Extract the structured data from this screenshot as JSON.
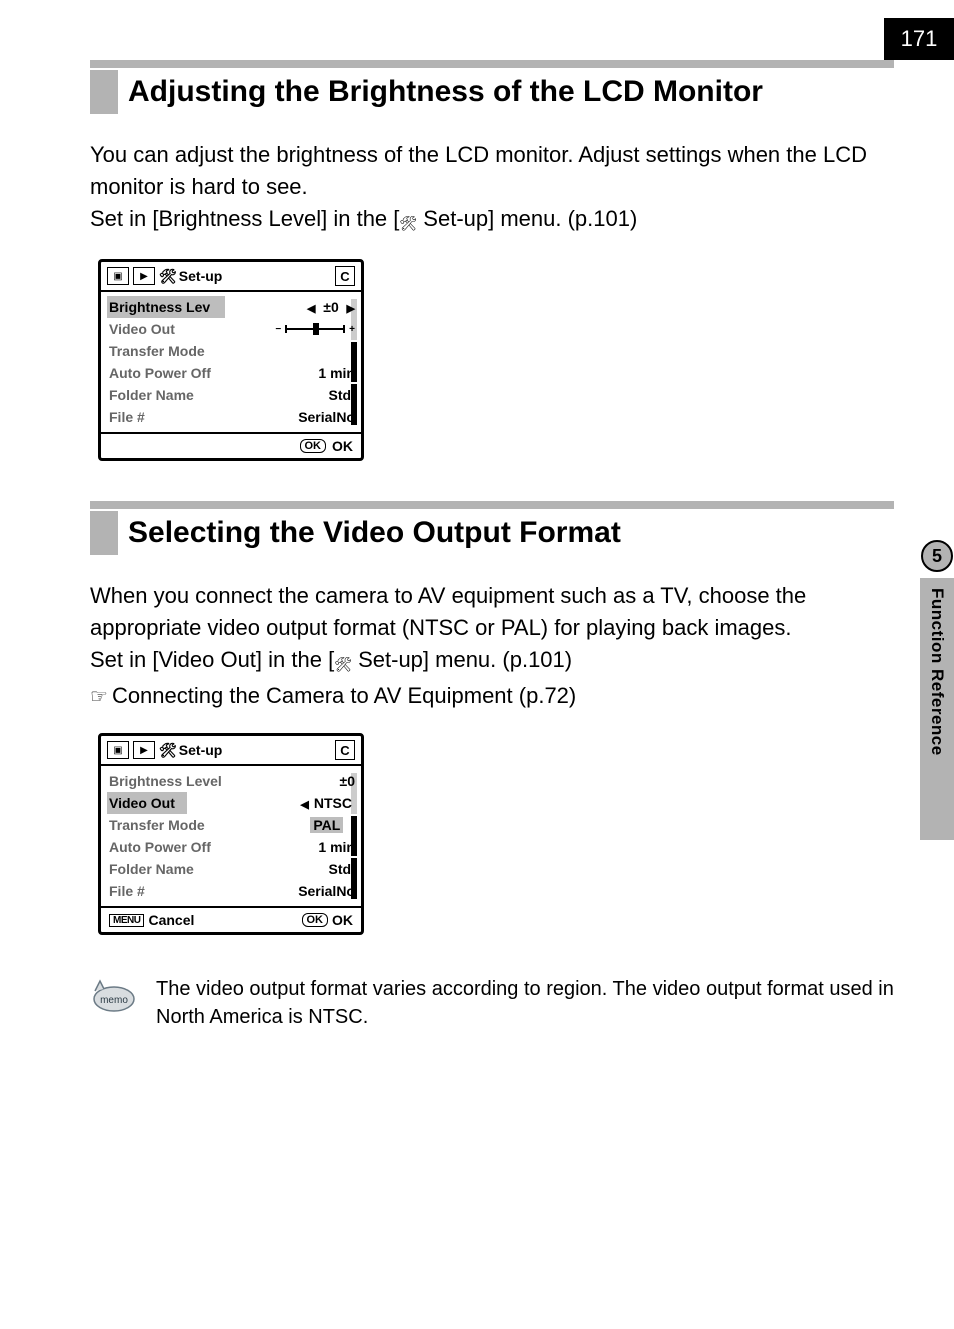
{
  "page_number": "171",
  "side_tab": {
    "number": "5",
    "label": "Function Reference"
  },
  "section1": {
    "heading": "Adjusting the Brightness of the LCD Monitor",
    "para": "You can adjust the brightness of the LCD monitor. Adjust settings when the LCD monitor is hard to see.",
    "set_line_before": "Set in [Brightness Level] in the [",
    "set_line_after": " Set-up] menu. (p.101)",
    "menu": {
      "setup_label": "Set-up",
      "c_badge": "C",
      "rows": {
        "brightness": {
          "label": "Brightness Lev",
          "value": "0"
        },
        "video_out": {
          "label": "Video Out"
        },
        "transfer": {
          "label": "Transfer Mode"
        },
        "auto_off": {
          "label": "Auto Power Off",
          "value": "1 min"
        },
        "folder": {
          "label": "Folder Name",
          "value": "Std."
        },
        "file": {
          "label": "File #",
          "value": "SerialNo"
        }
      },
      "ok_badge": "OK",
      "ok_label": "OK"
    }
  },
  "section2": {
    "heading": "Selecting the Video Output Format",
    "para": "When you connect the camera to AV equipment such as a TV, choose the appropriate video output format (NTSC or PAL) for playing back images.",
    "set_line_before": "Set in [Video Out] in the [",
    "set_line_after": " Set-up] menu. (p.101)",
    "xref": "Connecting the Camera to AV Equipment (p.72)",
    "menu": {
      "setup_label": "Set-up",
      "c_badge": "C",
      "rows": {
        "brightness": {
          "label": "Brightness Level",
          "value": "0"
        },
        "video_out": {
          "label": "Video Out",
          "opt_selected": "NTSC",
          "opt_other": "PAL"
        },
        "transfer": {
          "label": "Transfer Mode"
        },
        "auto_off": {
          "label": "Auto Power Off",
          "value": "1 min"
        },
        "folder": {
          "label": "Folder Name",
          "value": "Std."
        },
        "file": {
          "label": "File #",
          "value": "SerialNo"
        }
      },
      "menu_badge": "MENU",
      "cancel_label": "Cancel",
      "ok_badge": "OK",
      "ok_label": "OK"
    }
  },
  "memo": {
    "label": "memo",
    "text": "The video output format varies according to region. The video output format used in North America is NTSC."
  }
}
